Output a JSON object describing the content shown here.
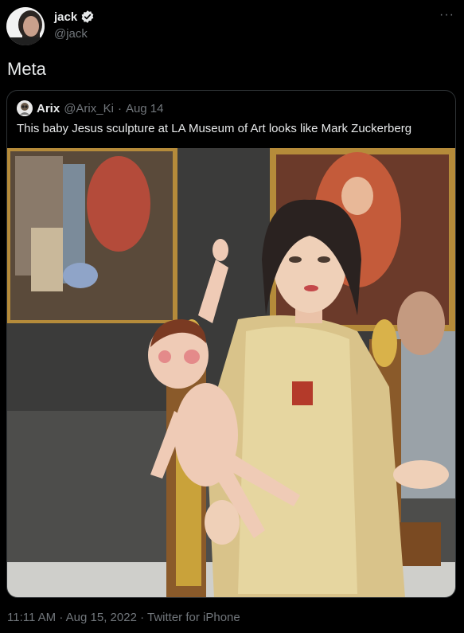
{
  "tweet": {
    "author_name": "jack",
    "author_handle": "@jack",
    "verified_icon": "verified-badge-icon",
    "more_icon": "···",
    "text": "Meta"
  },
  "quoted_tweet": {
    "author_name": "Arix",
    "author_handle": "@Arix_Ki",
    "separator": "·",
    "date": "Aug 14",
    "text": "This baby Jesus sculpture at LA Museum of Art looks like Mark Zuckerberg"
  },
  "footer": {
    "time": "11:11 AM",
    "sep1": "·",
    "date": "Aug 15, 2022",
    "sep2": "·",
    "source": "Twitter for iPhone"
  },
  "colors": {
    "background": "#000000",
    "primary_text": "#e7e9ea",
    "secondary_text": "#71767b",
    "border": "#2f3336"
  }
}
